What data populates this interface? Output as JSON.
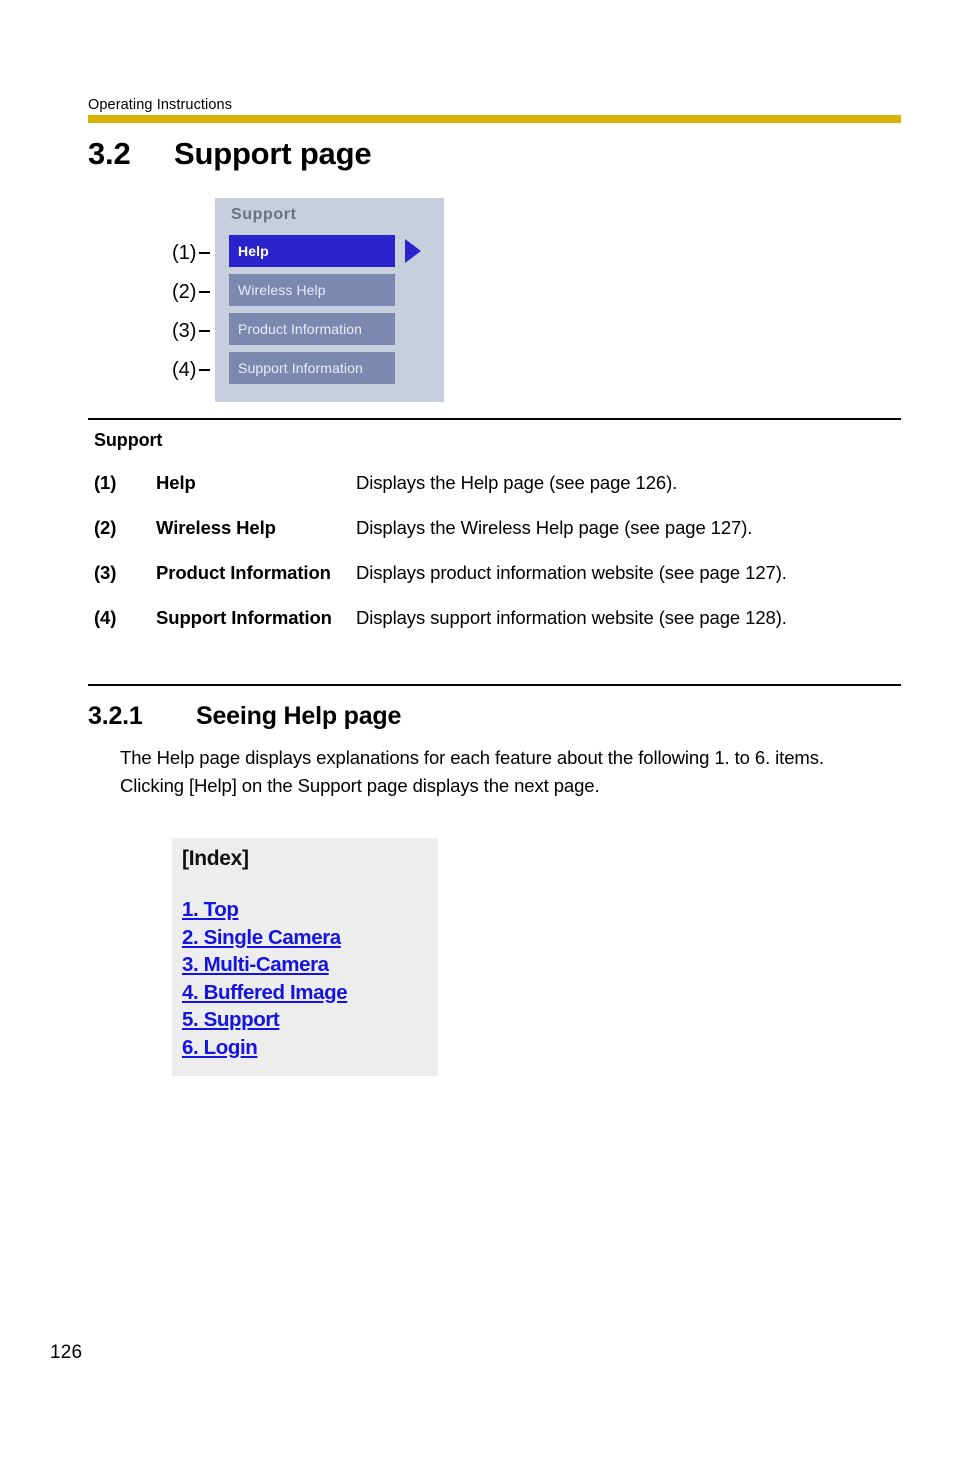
{
  "header": {
    "running_title": "Operating Instructions",
    "rule_color": "#d9b205"
  },
  "section": {
    "number": "3.2",
    "title": "Support page"
  },
  "support_figure": {
    "menu_title": "Support",
    "callouts": [
      "(1)",
      "(2)",
      "(3)",
      "(4)"
    ],
    "items": [
      {
        "label": "Help",
        "selected": true
      },
      {
        "label": "Wireless Help",
        "selected": false
      },
      {
        "label": "Product Information",
        "selected": false
      },
      {
        "label": "Support Information",
        "selected": false
      }
    ],
    "selected_bg": "#2a23cc",
    "item_bg": "#7b88b0",
    "panel_bg": "#c7cedd",
    "arrow_icon": "right-triangle-icon"
  },
  "definitions": {
    "title": "Support",
    "rows": [
      {
        "num": "(1)",
        "term": "Help",
        "desc": "Displays the Help page (see page 126)."
      },
      {
        "num": "(2)",
        "term": "Wireless Help",
        "desc": "Displays the Wireless Help page (see page 127)."
      },
      {
        "num": "(3)",
        "term": "Product Information",
        "desc": "Displays product information website (see page 127)."
      },
      {
        "num": "(4)",
        "term": "Support Information",
        "desc": "Displays support information website (see page 128)."
      }
    ]
  },
  "subsection": {
    "number": "3.2.1",
    "title": "Seeing Help page",
    "paragraph_1": "The Help page displays explanations for each feature about the following 1. to 6. items.",
    "paragraph_2": "Clicking [Help] on the Support page displays the next page."
  },
  "index_figure": {
    "title": "[Index]",
    "link_color": "#1414e0",
    "background": "#ededed",
    "links": [
      "1. Top",
      "2. Single Camera",
      "3. Multi-Camera",
      "4. Buffered Image",
      "5. Support",
      "6. Login"
    ]
  },
  "footer": {
    "page_number": "126"
  }
}
